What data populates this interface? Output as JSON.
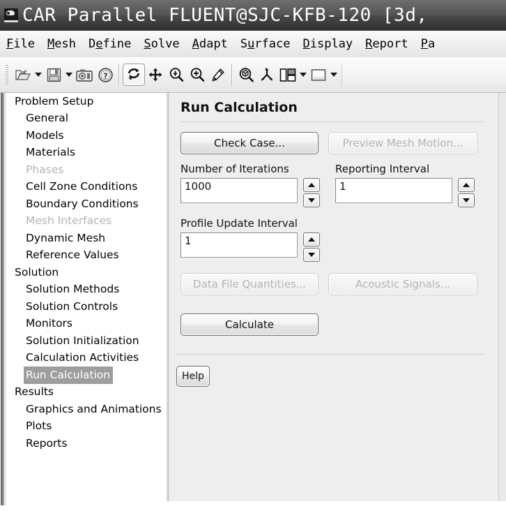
{
  "window": {
    "title": "CAR Parallel FLUENT@SJC-KFB-120  [3d,",
    "icon": "fluent-app-icon"
  },
  "menubar": {
    "items": [
      {
        "pre": "",
        "mn": "F",
        "post": "ile"
      },
      {
        "pre": "",
        "mn": "M",
        "post": "esh"
      },
      {
        "pre": "D",
        "mn": "e",
        "post": "fine"
      },
      {
        "pre": "",
        "mn": "S",
        "post": "olve"
      },
      {
        "pre": "",
        "mn": "A",
        "post": "dapt"
      },
      {
        "pre": "S",
        "mn": "u",
        "post": "rface"
      },
      {
        "pre": "",
        "mn": "D",
        "post": "isplay"
      },
      {
        "pre": "",
        "mn": "R",
        "post": "eport"
      },
      {
        "pre": "",
        "mn": "P",
        "post": "a"
      }
    ]
  },
  "toolbar": {
    "buttons": [
      {
        "name": "open-file-icon",
        "caret": true
      },
      {
        "name": "save-file-icon",
        "caret": true
      },
      {
        "name": "camera-snapshot-icon",
        "caret": false
      },
      {
        "name": "help-icon",
        "caret": false
      },
      {
        "name": "rotate-view-icon",
        "caret": false,
        "selected": true
      },
      {
        "name": "pan-view-icon",
        "caret": false
      },
      {
        "name": "zoom-out-icon",
        "caret": false
      },
      {
        "name": "zoom-in-icon",
        "caret": false
      },
      {
        "name": "probe-eyedropper-icon",
        "caret": false
      },
      {
        "name": "fit-to-window-icon",
        "caret": false
      },
      {
        "name": "axes-triad-icon",
        "caret": false
      },
      {
        "name": "viewport-layout-icon",
        "caret": true
      },
      {
        "name": "view-window-icon",
        "caret": true
      }
    ]
  },
  "tree": {
    "items": [
      {
        "label": "Problem Setup",
        "level": 0,
        "disabled": false,
        "selected": false
      },
      {
        "label": "General",
        "level": 1,
        "disabled": false,
        "selected": false
      },
      {
        "label": "Models",
        "level": 1,
        "disabled": false,
        "selected": false
      },
      {
        "label": "Materials",
        "level": 1,
        "disabled": false,
        "selected": false
      },
      {
        "label": "Phases",
        "level": 1,
        "disabled": true,
        "selected": false
      },
      {
        "label": "Cell Zone Conditions",
        "level": 1,
        "disabled": false,
        "selected": false
      },
      {
        "label": "Boundary Conditions",
        "level": 1,
        "disabled": false,
        "selected": false
      },
      {
        "label": "Mesh Interfaces",
        "level": 1,
        "disabled": true,
        "selected": false
      },
      {
        "label": "Dynamic Mesh",
        "level": 1,
        "disabled": false,
        "selected": false
      },
      {
        "label": "Reference Values",
        "level": 1,
        "disabled": false,
        "selected": false
      },
      {
        "label": "Solution",
        "level": 0,
        "disabled": false,
        "selected": false
      },
      {
        "label": "Solution Methods",
        "level": 1,
        "disabled": false,
        "selected": false
      },
      {
        "label": "Solution Controls",
        "level": 1,
        "disabled": false,
        "selected": false
      },
      {
        "label": "Monitors",
        "level": 1,
        "disabled": false,
        "selected": false
      },
      {
        "label": "Solution Initialization",
        "level": 1,
        "disabled": false,
        "selected": false
      },
      {
        "label": "Calculation Activities",
        "level": 1,
        "disabled": false,
        "selected": false
      },
      {
        "label": "Run Calculation",
        "level": 1,
        "disabled": false,
        "selected": true
      },
      {
        "label": "Results",
        "level": 0,
        "disabled": false,
        "selected": false
      },
      {
        "label": "Graphics and Animations",
        "level": 1,
        "disabled": false,
        "selected": false
      },
      {
        "label": "Plots",
        "level": 1,
        "disabled": false,
        "selected": false
      },
      {
        "label": "Reports",
        "level": 1,
        "disabled": false,
        "selected": false
      }
    ]
  },
  "panel": {
    "title": "Run Calculation",
    "check_case_label": "Check Case...",
    "preview_mesh_motion_label": "Preview Mesh Motion...",
    "number_of_iterations": {
      "label": "Number of Iterations",
      "value": "1000"
    },
    "reporting_interval": {
      "label": "Reporting Interval",
      "value": "1"
    },
    "profile_update_interval": {
      "label": "Profile Update Interval",
      "value": "1"
    },
    "data_file_quantities_label": "Data File Quantities...",
    "acoustic_signals_label": "Acoustic Signals...",
    "calculate_label": "Calculate",
    "help_label": "Help"
  },
  "colors": {
    "titlebar": "#4a4a4a",
    "panel_bg": "#eeeeee",
    "selection": "#9d9d9d",
    "disabled_text": "#b3b3b3"
  }
}
